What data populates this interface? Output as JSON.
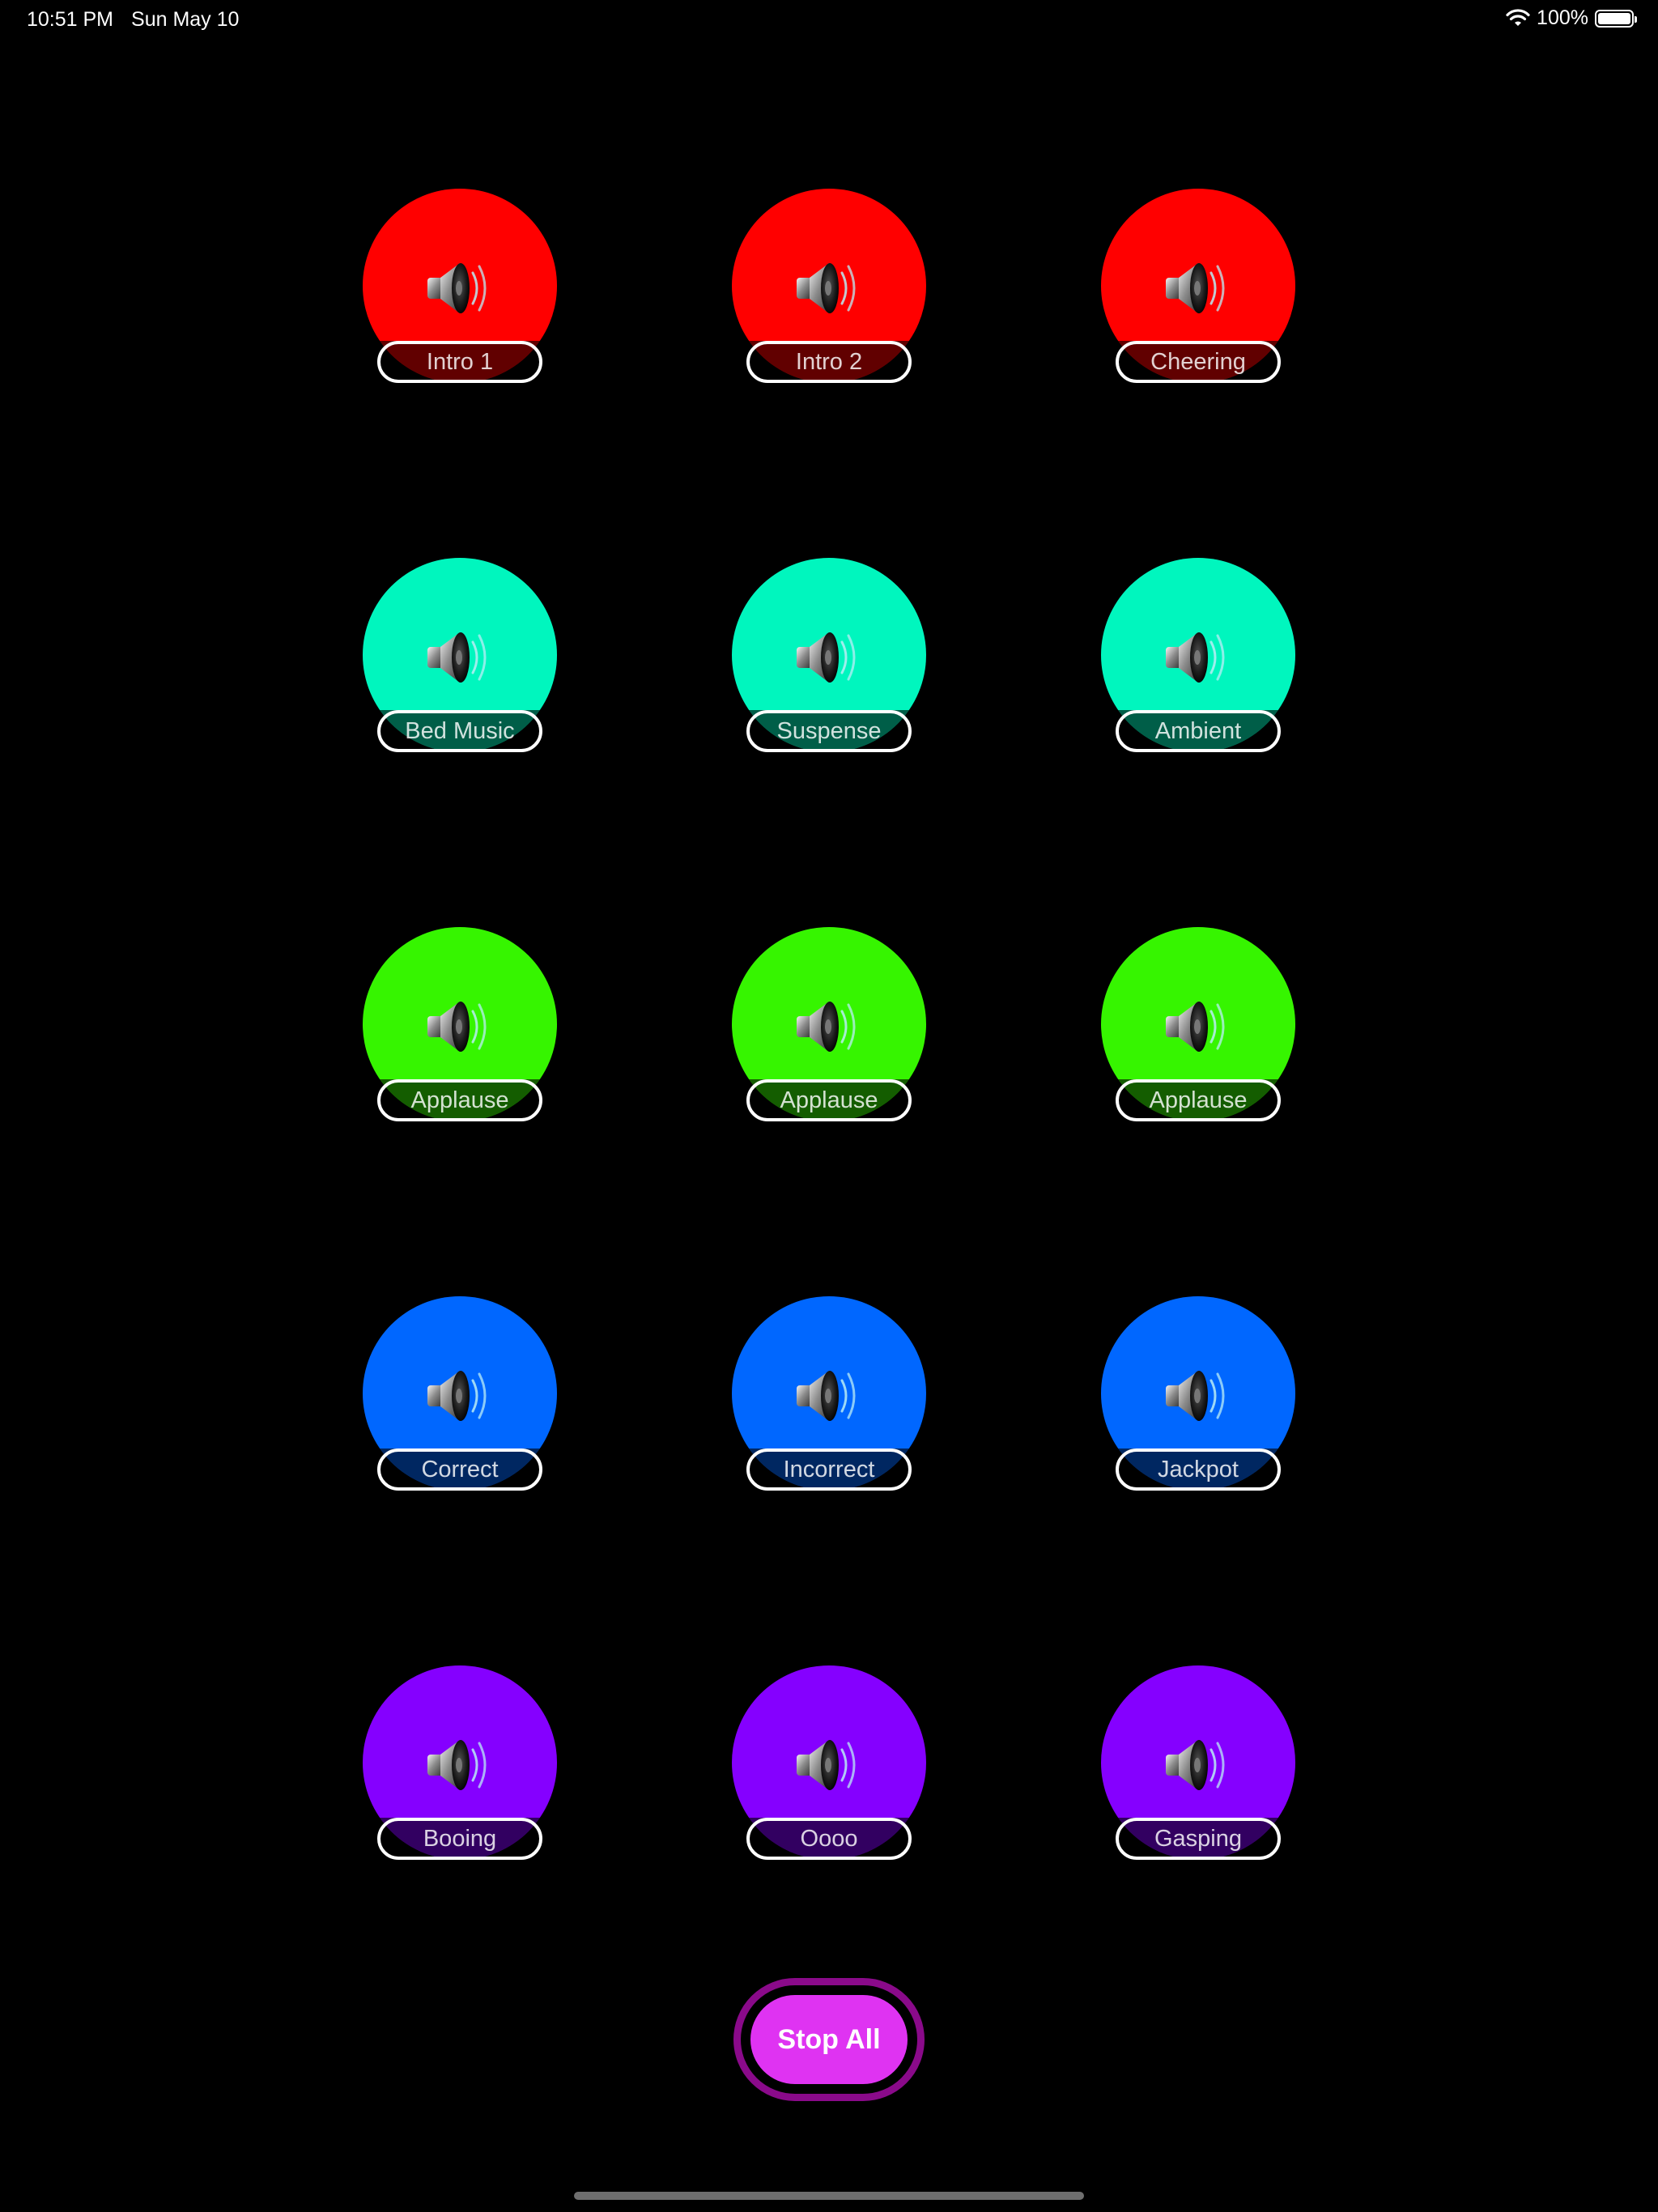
{
  "status_bar": {
    "time": "10:51 PM",
    "date": "Sun May 10",
    "battery_percent": "100%",
    "battery_level": 1.0
  },
  "pads": [
    {
      "label": "Intro 1",
      "color": "#ff0000"
    },
    {
      "label": "Intro 2",
      "color": "#ff0000"
    },
    {
      "label": "Cheering",
      "color": "#ff0000"
    },
    {
      "label": "Bed Music",
      "color": "#00f6be"
    },
    {
      "label": "Suspense",
      "color": "#00f6be"
    },
    {
      "label": "Ambient",
      "color": "#00f6be"
    },
    {
      "label": "Applause",
      "color": "#36f500"
    },
    {
      "label": "Applause",
      "color": "#36f500"
    },
    {
      "label": "Applause",
      "color": "#36f500"
    },
    {
      "label": "Correct",
      "color": "#0067ff"
    },
    {
      "label": "Incorrect",
      "color": "#0067ff"
    },
    {
      "label": "Jackpot",
      "color": "#0067ff"
    },
    {
      "label": "Booing",
      "color": "#8500ff"
    },
    {
      "label": "Oooo",
      "color": "#8500ff"
    },
    {
      "label": "Gasping",
      "color": "#8500ff"
    }
  ],
  "pad_icon": "speaker-icon",
  "stop_all": {
    "label": "Stop All",
    "color": "#df33f2",
    "ring_color": "#8a0a8a"
  }
}
